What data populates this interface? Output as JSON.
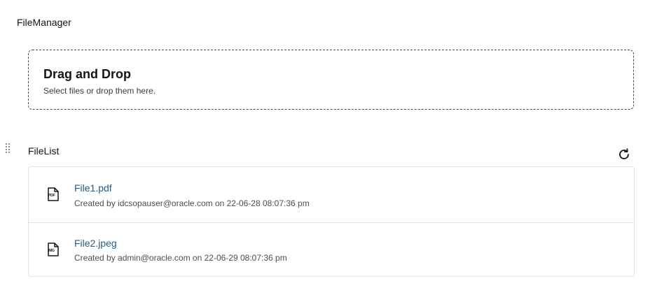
{
  "file_manager": {
    "title": "FileManager"
  },
  "dropzone": {
    "title": "Drag and Drop",
    "subtitle": "Select files or drop them here."
  },
  "file_list": {
    "title": "FileList",
    "refresh_icon": "refresh-icon",
    "drag_handle_icon": "drag-handle-icon",
    "items": [
      {
        "name": "File1.pdf",
        "icon_tag": "PDF",
        "meta": "Created by idcsopauser@oracle.com on 22-06-28 08:07:36 pm"
      },
      {
        "name": "File2.jpeg",
        "icon_tag": "IMG",
        "meta": "Created by admin@oracle.com on 22-06-29 08:07:36 pm"
      }
    ]
  },
  "colors": {
    "link": "#235c8a",
    "text": "#161513",
    "border": "#e4e1dd"
  }
}
